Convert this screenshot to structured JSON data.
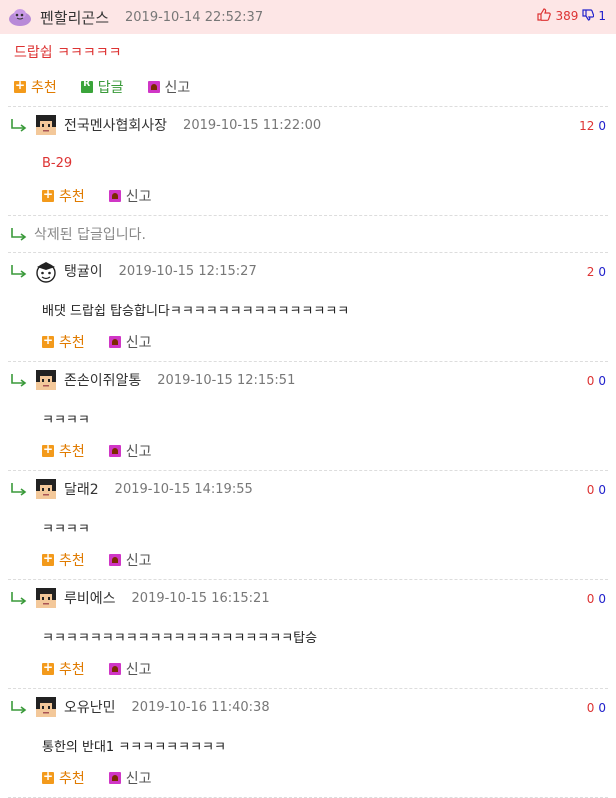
{
  "post": {
    "author": "펜할리곤스",
    "date": "2019-10-14 22:52:37",
    "up": "389",
    "down": "1",
    "title": "드랍쉽 ㅋㅋㅋㅋㅋ",
    "actions": {
      "recommend": "추천",
      "reply": "답글",
      "report": "신고"
    }
  },
  "comments": [
    {
      "author": "전국멘사협회사장",
      "date": "2019-10-15 11:22:00",
      "up": "12",
      "down": "0",
      "body": "B-29",
      "recommend": "추천",
      "report": "신고"
    },
    {
      "deleted": "삭제된 답글입니다."
    },
    {
      "author": "탱귤이",
      "date": "2019-10-15 12:15:27",
      "up": "2",
      "down": "0",
      "body": "배댓 드랍쉽 탑승합니다ㅋㅋㅋㅋㅋㅋㅋㅋㅋㅋㅋㅋㅋㅋㅋ",
      "recommend": "추천",
      "report": "신고"
    },
    {
      "author": "존손이쥐알통",
      "date": "2019-10-15 12:15:51",
      "up": "0",
      "down": "0",
      "body": "ㅋㅋㅋㅋ",
      "recommend": "추천",
      "report": "신고"
    },
    {
      "author": "달래2",
      "date": "2019-10-15 14:19:55",
      "up": "0",
      "down": "0",
      "body": "ㅋㅋㅋㅋ",
      "recommend": "추천",
      "report": "신고"
    },
    {
      "author": "루비에스",
      "date": "2019-10-15 16:15:21",
      "up": "0",
      "down": "0",
      "body": "ㅋㅋㅋㅋㅋㅋㅋㅋㅋㅋㅋㅋㅋㅋㅋㅋㅋㅋㅋㅋㅋ탑승",
      "recommend": "추천",
      "report": "신고"
    },
    {
      "author": "오유난민",
      "date": "2019-10-16 11:40:38",
      "up": "0",
      "down": "0",
      "body": "통한의 반대1 ㅋㅋㅋㅋㅋㅋㅋㅋㅋ",
      "recommend": "추천",
      "report": "신고"
    }
  ],
  "colors": {
    "up": "#dd3333",
    "down": "#2222cc",
    "header_bg": "#fde6e6",
    "accent": "#e07b00",
    "reply": "#3a9a3a"
  }
}
